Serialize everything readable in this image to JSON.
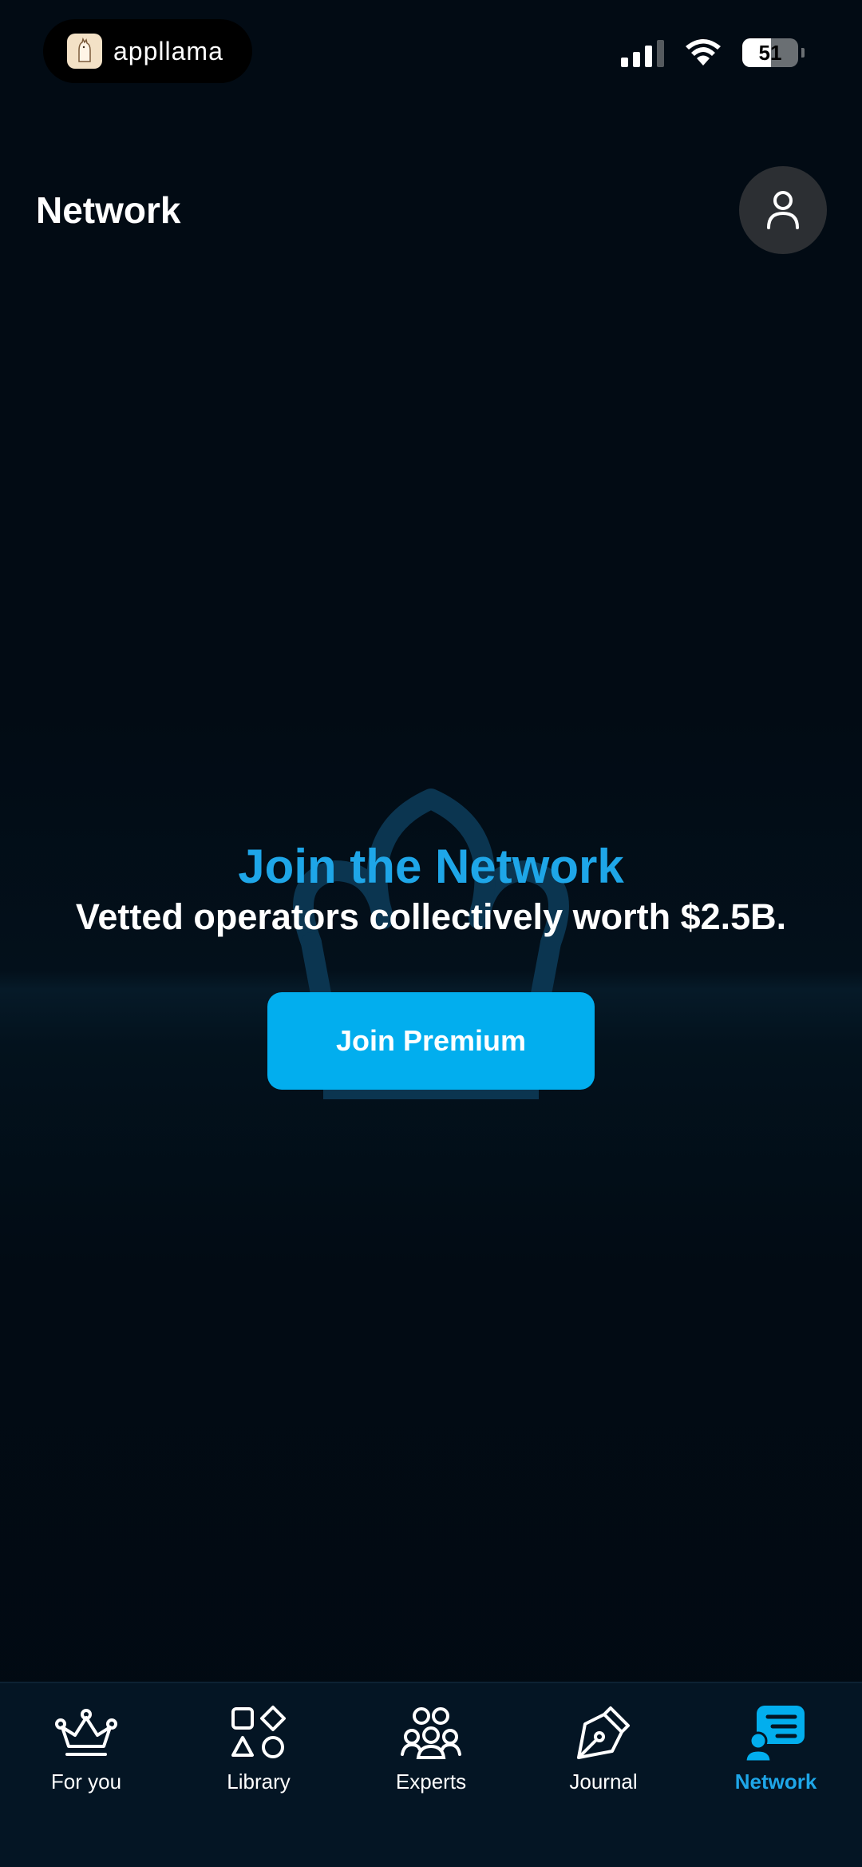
{
  "status_bar": {
    "app_name": "appllama",
    "battery": "51",
    "battery_level": 0.51
  },
  "header": {
    "title": "Network"
  },
  "hero": {
    "title": "Join the Network",
    "subtitle": "Vetted operators collectively worth $2.5B.",
    "button_label": "Join Premium"
  },
  "tabs": [
    {
      "label": "For you",
      "icon": "crown-icon",
      "active": false
    },
    {
      "label": "Library",
      "icon": "shapes-icon",
      "active": false
    },
    {
      "label": "Experts",
      "icon": "people-icon",
      "active": false
    },
    {
      "label": "Journal",
      "icon": "pen-nib-icon",
      "active": false
    },
    {
      "label": "Network",
      "icon": "chat-person-icon",
      "active": true
    }
  ],
  "colors": {
    "accent": "#1ea6e8",
    "button": "#02aeee",
    "background": "#020b14",
    "tabbar": "#041524"
  }
}
